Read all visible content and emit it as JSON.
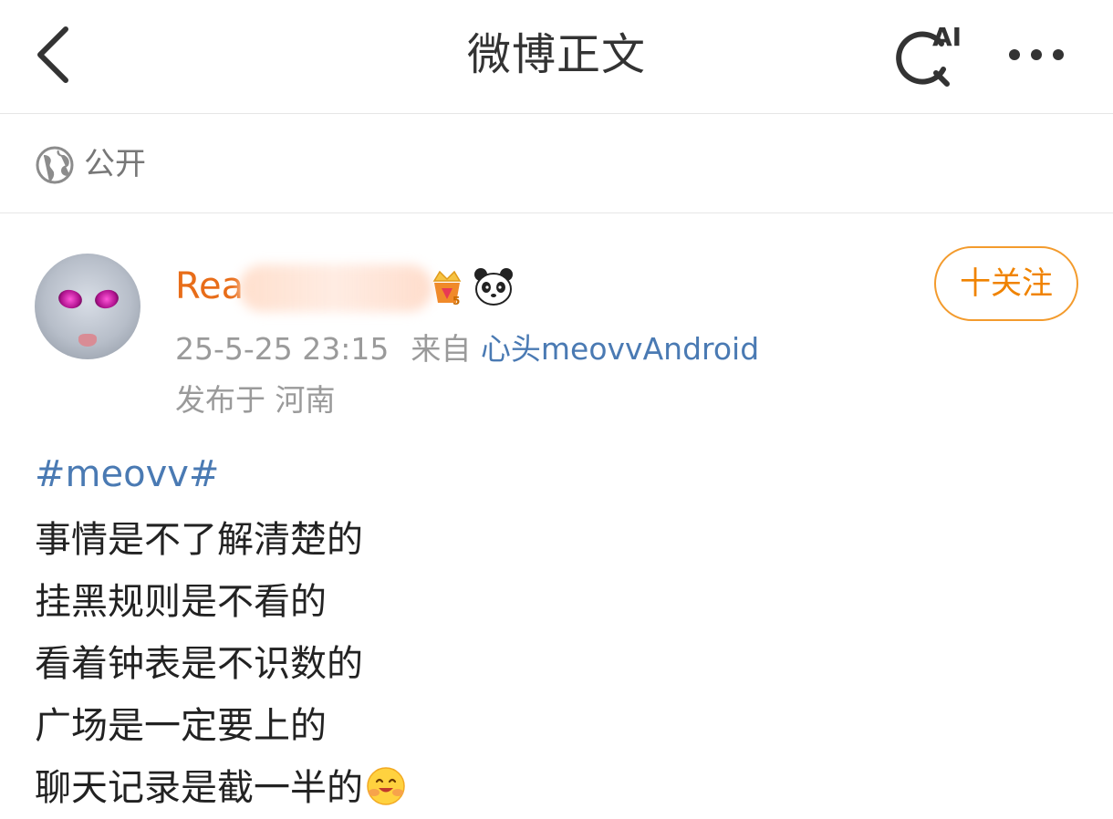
{
  "header": {
    "title": "微博正文",
    "ai_label": "AI"
  },
  "visibility": {
    "label": "公开"
  },
  "post": {
    "user": {
      "name_visible": "Rea",
      "follow_label": "十关注"
    },
    "meta": {
      "time": "25-5-25 23:15",
      "source_prefix": "来自",
      "source_name": "心头meovvAndroid",
      "location": "发布于 河南"
    },
    "hashtag": "#meovv#",
    "lines": [
      "事情是不了解清楚的",
      "挂黑规则是不看的",
      "看着钟表是不识数的",
      "广场是一定要上的",
      "聊天记录是截一半的"
    ]
  },
  "colors": {
    "username": "#e86d19",
    "link": "#4a7ab3",
    "follow_border": "#f39b2d",
    "meta_gray": "#9a9a9a"
  },
  "icons": [
    "back-chevron-icon",
    "ai-search-icon",
    "more-dots-icon",
    "globe-icon",
    "vip-crown-badge-icon",
    "panda-emoji-icon",
    "hug-emoji-icon"
  ]
}
